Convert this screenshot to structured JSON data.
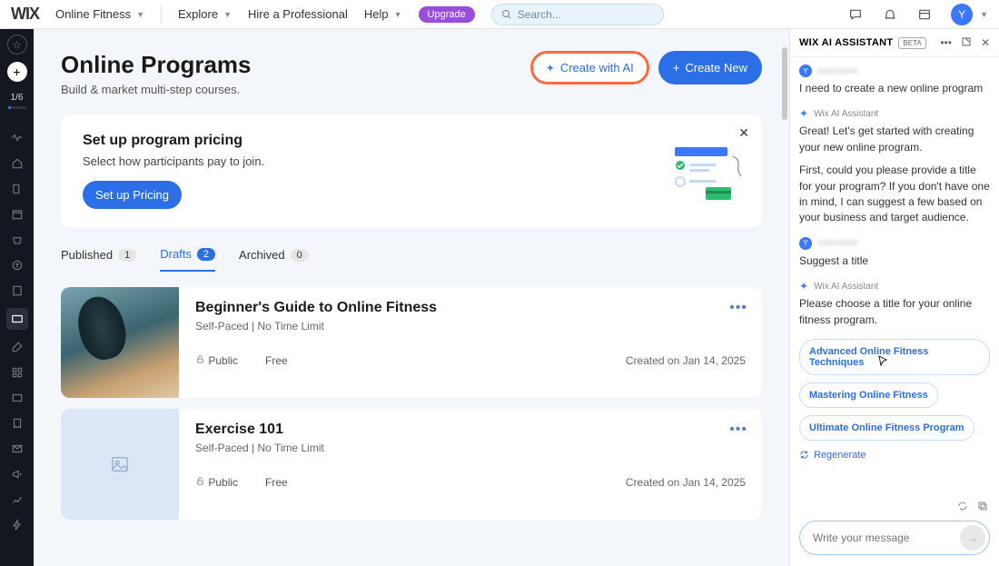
{
  "topbar": {
    "logo": "WIX",
    "sitename": "Online Fitness",
    "nav": [
      "Explore",
      "Hire a Professional",
      "Help"
    ],
    "upgrade": "Upgrade",
    "search_placeholder": "Search...",
    "avatar": "Y"
  },
  "leftbar": {
    "counter": "1/6"
  },
  "header": {
    "title": "Online Programs",
    "subtitle": "Build & market multi-step courses.",
    "create_ai": "Create with AI",
    "create_new": "Create New"
  },
  "setup_card": {
    "title": "Set up program pricing",
    "subtitle": "Select how participants pay to join.",
    "button": "Set up Pricing"
  },
  "tabs": {
    "published": {
      "label": "Published",
      "count": "1"
    },
    "drafts": {
      "label": "Drafts",
      "count": "2"
    },
    "archived": {
      "label": "Archived",
      "count": "0"
    }
  },
  "programs": [
    {
      "title": "Beginner's Guide to Online Fitness",
      "meta": "Self-Paced | No Time Limit",
      "visibility": "Public",
      "price": "Free",
      "created": "Created on Jan 14, 2025"
    },
    {
      "title": "Exercise 101",
      "meta": "Self-Paced | No Time Limit",
      "visibility": "Public",
      "price": "Free",
      "created": "Created on Jan 14, 2025"
    }
  ],
  "assistant": {
    "title": "WIX AI ASSISTANT",
    "beta": "BETA",
    "ai_name": "Wix AI Assistant",
    "user_msg1": "I need to create a new online program",
    "ai_msg1": "Great! Let's get started with creating your new online program.",
    "ai_msg1b": "First, could you please provide a title for your program? If you don't have one in mind, I can suggest a few based on your business and target audience.",
    "user_msg2": "Suggest a title",
    "ai_msg2": "Please choose a title for your online fitness program.",
    "suggestions": [
      "Advanced Online Fitness Techniques",
      "Mastering Online Fitness",
      "Ultimate Online Fitness Program"
    ],
    "regenerate": "Regenerate",
    "input_placeholder": "Write your message"
  }
}
